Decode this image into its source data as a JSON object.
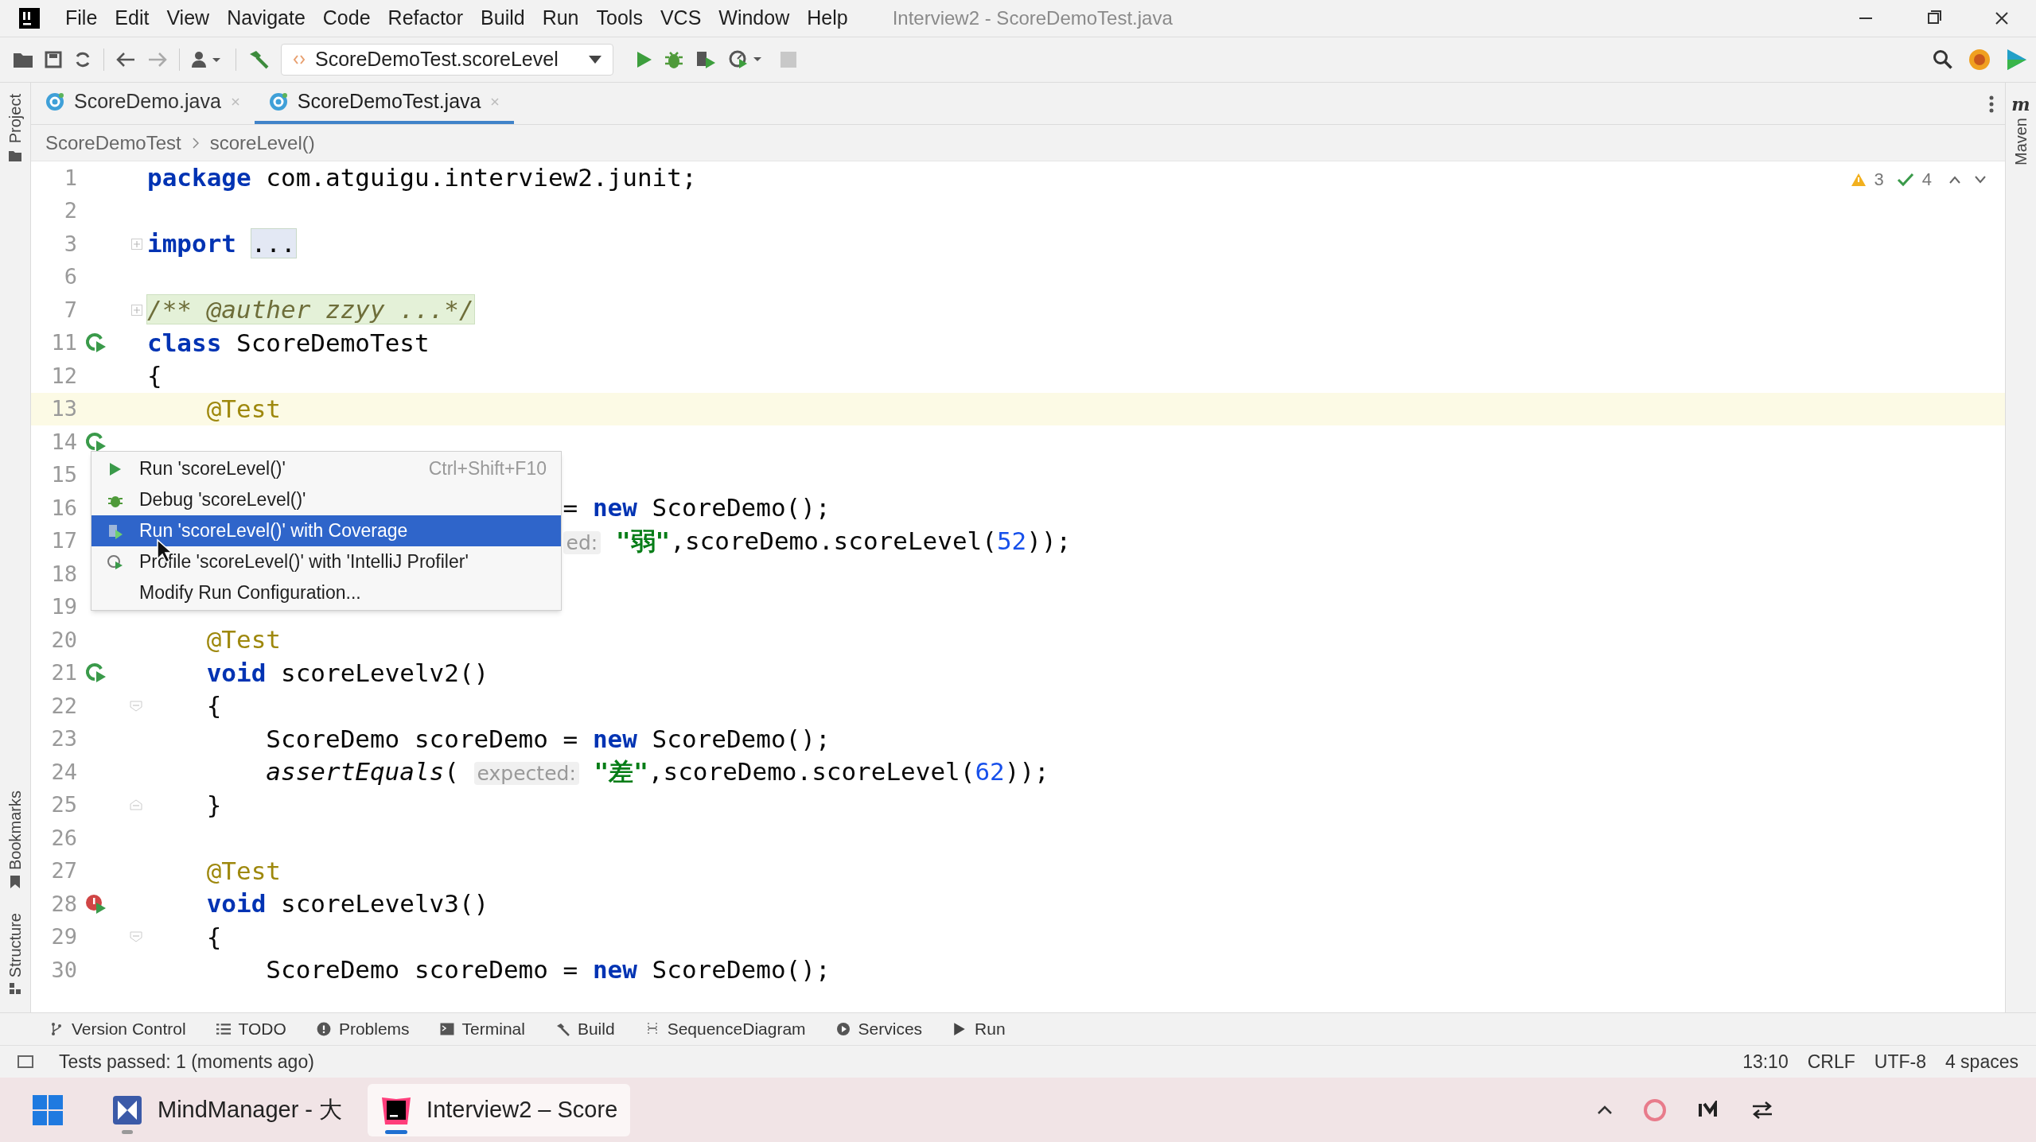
{
  "window": {
    "title": "Interview2 - ScoreDemoTest.java"
  },
  "menu": [
    "File",
    "Edit",
    "View",
    "Navigate",
    "Code",
    "Refactor",
    "Build",
    "Run",
    "Tools",
    "VCS",
    "Window",
    "Help"
  ],
  "toolbar": {
    "run_config": "ScoreDemoTest.scoreLevel"
  },
  "left_strip": {
    "top": [
      "Project"
    ],
    "bottom": [
      "Bookmarks",
      "Structure"
    ]
  },
  "right_strip": {
    "logo": "m",
    "tabs": [
      "Maven"
    ]
  },
  "editor_tabs": [
    {
      "label": "ScoreDemo.java",
      "selected": false
    },
    {
      "label": "ScoreDemoTest.java",
      "selected": true
    }
  ],
  "breadcrumbs": [
    "ScoreDemoTest",
    "scoreLevel()"
  ],
  "inspections": {
    "warnings": "3",
    "checks": "4"
  },
  "code_lines": [
    {
      "number": "1",
      "current": false,
      "tokens": [
        {
          "kind": "keyword",
          "text": "package"
        },
        {
          "kind": "plain",
          "text": " com.atguigu.interview2.junit;"
        }
      ]
    },
    {
      "number": "2",
      "current": false
    },
    {
      "number": "3",
      "current": false,
      "fold_marker": {
        "collapsed": true
      },
      "tokens": [
        {
          "kind": "keyword",
          "text": "import"
        },
        {
          "kind": "folded",
          "text": " ..."
        }
      ]
    },
    {
      "number": "6",
      "current": false
    },
    {
      "number": "7",
      "current": false,
      "fold_marker": {
        "collapsed": true
      },
      "tokens": [
        {
          "kind": "folded-comment",
          "text": "/** @auther zzyy ...*/"
        }
      ]
    },
    {
      "number": "11",
      "current": false,
      "run_marker": {
        "failed": false
      },
      "tokens": [
        {
          "kind": "keyword",
          "text": "class"
        },
        {
          "kind": "plain",
          "text": " ScoreDemoTest"
        }
      ]
    },
    {
      "number": "12",
      "current": false,
      "tokens": [
        {
          "kind": "plain",
          "text": "{"
        }
      ]
    },
    {
      "number": "13",
      "current": true,
      "tokens": [
        {
          "kind": "annotation",
          "text": "    @Test"
        }
      ]
    },
    {
      "number": "14",
      "current": false,
      "run_marker": {
        "failed": false
      }
    },
    {
      "number": "15",
      "current": false
    },
    {
      "number": "16",
      "current": false,
      "tokens": [
        {
          "kind": "plain",
          "text": "                            = "
        },
        {
          "kind": "keyword",
          "text": "new"
        },
        {
          "kind": "plain",
          "text": " ScoreDemo();"
        }
      ]
    },
    {
      "number": "17",
      "current": false,
      "tokens": [
        {
          "kind": "hint",
          "text": "                            ed:"
        },
        {
          "kind": "string",
          "text": " \"弱\""
        },
        {
          "kind": "plain",
          "text": ",scoreDemo.scoreLevel("
        },
        {
          "kind": "number",
          "text": "52"
        },
        {
          "kind": "plain",
          "text": "));"
        }
      ]
    },
    {
      "number": "18",
      "current": false
    },
    {
      "number": "19",
      "current": false
    },
    {
      "number": "20",
      "current": false,
      "tokens": [
        {
          "kind": "annotation",
          "text": "    @Test"
        }
      ]
    },
    {
      "number": "21",
      "current": false,
      "run_marker": {
        "failed": false
      },
      "tokens": [
        {
          "kind": "keyword",
          "text": "    void"
        },
        {
          "kind": "plain",
          "text": " scoreLevelv2()"
        }
      ]
    },
    {
      "number": "22",
      "current": false,
      "fold_marker": {
        "collapsed": false,
        "closing": false
      },
      "tokens": [
        {
          "kind": "plain",
          "text": "    {"
        }
      ]
    },
    {
      "number": "23",
      "current": false,
      "tokens": [
        {
          "kind": "plain",
          "text": "        ScoreDemo scoreDemo = "
        },
        {
          "kind": "keyword",
          "text": "new"
        },
        {
          "kind": "plain",
          "text": " ScoreDemo();"
        }
      ]
    },
    {
      "number": "24",
      "current": false,
      "tokens": [
        {
          "kind": "italic",
          "text": "        assertEquals"
        },
        {
          "kind": "plain",
          "text": "( "
        },
        {
          "kind": "hint",
          "text": "expected:"
        },
        {
          "kind": "string",
          "text": " \"差\""
        },
        {
          "kind": "plain",
          "text": ",scoreDemo.scoreLevel("
        },
        {
          "kind": "number",
          "text": "62"
        },
        {
          "kind": "plain",
          "text": "));"
        }
      ]
    },
    {
      "number": "25",
      "current": false,
      "fold_marker": {
        "collapsed": false,
        "closing": true
      },
      "tokens": [
        {
          "kind": "plain",
          "text": "    }"
        }
      ]
    },
    {
      "number": "26",
      "current": false
    },
    {
      "number": "27",
      "current": false,
      "tokens": [
        {
          "kind": "annotation",
          "text": "    @Test"
        }
      ]
    },
    {
      "number": "28",
      "current": false,
      "run_marker": {
        "failed": true
      },
      "tokens": [
        {
          "kind": "keyword",
          "text": "    void"
        },
        {
          "kind": "plain",
          "text": " scoreLevelv3()"
        }
      ]
    },
    {
      "number": "29",
      "current": false,
      "fold_marker": {
        "collapsed": false,
        "closing": false
      },
      "tokens": [
        {
          "kind": "plain",
          "text": "    {"
        }
      ]
    },
    {
      "number": "30",
      "current": false,
      "tokens": [
        {
          "kind": "plain",
          "text": "        ScoreDemo scoreDemo = "
        },
        {
          "kind": "keyword",
          "text": "new"
        },
        {
          "kind": "plain",
          "text": " ScoreDemo();"
        }
      ]
    }
  ],
  "popup_menu": [
    {
      "label": "Run 'scoreLevel()'",
      "shortcut": "Ctrl+Shift+F10",
      "kind": "run",
      "selected": false
    },
    {
      "label": "Debug 'scoreLevel()'",
      "kind": "debug",
      "selected": false
    },
    {
      "label": "Run 'scoreLevel()' with Coverage",
      "kind": "coverage",
      "selected": true
    },
    {
      "label": "Profile 'scoreLevel()' with 'IntelliJ Profiler'",
      "kind": "profiler",
      "selected": false
    },
    {
      "label": "Modify Run Configuration...",
      "kind": "plain",
      "selected": false
    }
  ],
  "tool_windows": [
    {
      "label": "Version Control",
      "kind": "branch"
    },
    {
      "label": "TODO",
      "kind": "list"
    },
    {
      "label": "Problems",
      "kind": "info"
    },
    {
      "label": "Terminal",
      "kind": "terminal"
    },
    {
      "label": "Build",
      "kind": "hammer"
    },
    {
      "label": "SequenceDiagram",
      "kind": "diagram"
    },
    {
      "label": "Services",
      "kind": "services"
    },
    {
      "label": "Run",
      "kind": "run"
    }
  ],
  "status": {
    "message": "Tests passed: 1 (moments ago)",
    "items": [
      "13:10",
      "CRLF",
      "UTF-8",
      "4 spaces"
    ]
  },
  "taskbar": [
    {
      "label": "MindManager - 大",
      "kind": "mindmanager",
      "selected": false
    },
    {
      "label": "Interview2 – Score",
      "kind": "intellij",
      "selected": true
    }
  ]
}
